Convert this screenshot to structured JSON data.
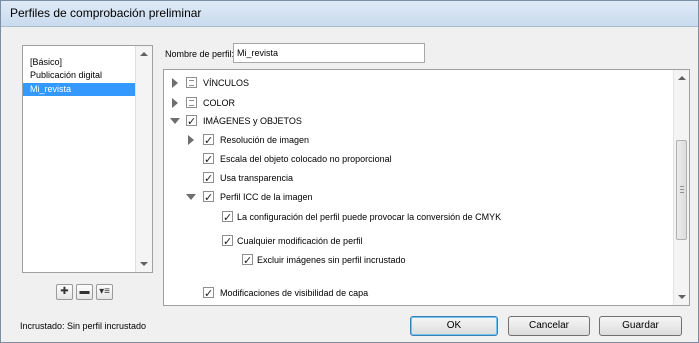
{
  "window": {
    "title": "Perfiles de comprobación preliminar"
  },
  "profiles": {
    "items": [
      {
        "label": "[Básico]",
        "selected": false
      },
      {
        "label": "Publicación digital",
        "selected": false
      },
      {
        "label": "Mi_revista",
        "selected": true
      }
    ],
    "buttons": [
      {
        "name": "new-profile-button",
        "glyph": "✚"
      },
      {
        "name": "delete-profile-button",
        "glyph": "▬"
      },
      {
        "name": "profile-menu-button",
        "glyph": "▾≡"
      }
    ]
  },
  "profile_name": {
    "label": "Nombre de perfil:",
    "value": "Mi_revista"
  },
  "tree": {
    "rows": [
      {
        "label": "VÍNCULOS",
        "expander": "collapsed",
        "check": "partial"
      },
      {
        "label": "COLOR",
        "expander": "collapsed",
        "check": "partial"
      },
      {
        "label": "IMÁGENES y OBJETOS",
        "expander": "expanded",
        "check": "checked"
      },
      {
        "label": "Resolución de imagen",
        "expander": "collapsed",
        "check": "checked"
      },
      {
        "label": "Escala del objeto colocado no proporcional",
        "expander": "none",
        "check": "checked"
      },
      {
        "label": "Usa transparencia",
        "expander": "none",
        "check": "checked"
      },
      {
        "label": "Perfil ICC de la imagen",
        "expander": "expanded",
        "check": "checked"
      },
      {
        "label": "La configuración del perfil puede provocar la conversión de CMYK",
        "expander": "none",
        "check": "checked"
      },
      {
        "label": "Cualquier modificación de perfil",
        "expander": "none",
        "check": "checked"
      },
      {
        "label": "Excluir imágenes sin perfil incrustado",
        "expander": "none",
        "check": "checked"
      },
      {
        "label": "Modificaciones de visibilidad de capa",
        "expander": "none",
        "check": "checked"
      }
    ]
  },
  "status": {
    "text": "Incrustado:  Sin perfil incrustado"
  },
  "actions": {
    "ok": "OK",
    "cancel": "Cancelar",
    "save": "Guardar"
  }
}
